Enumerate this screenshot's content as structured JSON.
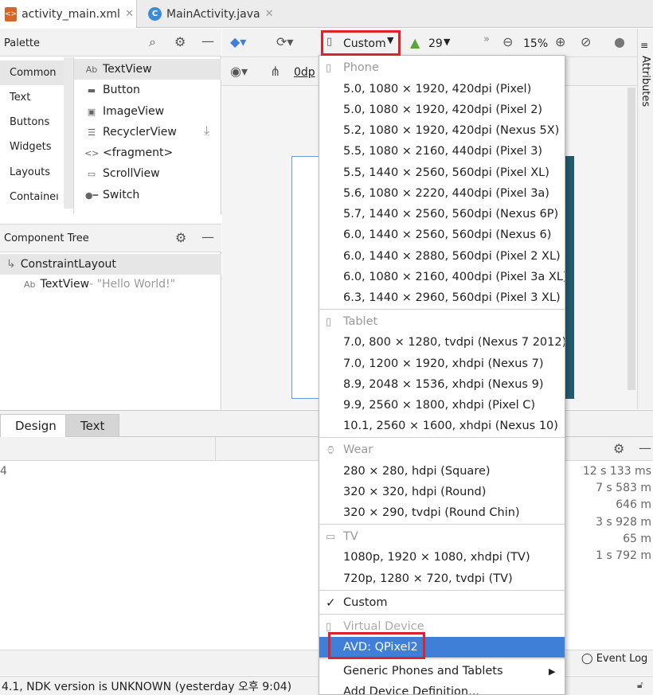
{
  "tabs": [
    {
      "label": "activity_main.xml",
      "active": true
    },
    {
      "label": "MainActivity.java",
      "active": false
    }
  ],
  "palette": {
    "title": "Palette",
    "categories": [
      "Common",
      "Text",
      "Buttons",
      "Widgets",
      "Layouts",
      "Containeı"
    ],
    "items": [
      "TextView",
      "Button",
      "ImageView",
      "RecyclerView",
      "<fragment>",
      "ScrollView",
      "Switch"
    ]
  },
  "component_tree": {
    "title": "Component Tree",
    "root": "ConstraintLayout",
    "child_label": "TextView",
    "child_value": "- \"Hello World!\""
  },
  "toolbar": {
    "device_label": "Custom",
    "api_level": "29",
    "zoom": "15%",
    "margin_value": "0dp"
  },
  "attributes_label": "Attributes",
  "design_tabs": [
    "Design",
    "Text"
  ],
  "run_timings": [
    "12 s 133 ms",
    "7 s 583 m",
    "646 m",
    "3 s 928 m",
    "65 m",
    "1 s 792 m"
  ],
  "run_left_text": "4",
  "event_log": "Event Log",
  "status_text": "4.1, NDK version is UNKNOWN (yesterday 오후 9:04)",
  "dropdown": {
    "phone_header": "Phone",
    "phone": [
      "5.0, 1080 × 1920, 420dpi (Pixel)",
      "5.0, 1080 × 1920, 420dpi (Pixel 2)",
      "5.2, 1080 × 1920, 420dpi (Nexus 5X)",
      "5.5, 1080 × 2160, 440dpi (Pixel 3)",
      "5.5, 1440 × 2560, 560dpi (Pixel XL)",
      "5.6, 1080 × 2220, 440dpi (Pixel 3a)",
      "5.7, 1440 × 2560, 560dpi (Nexus 6P)",
      "6.0, 1440 × 2560, 560dpi (Nexus 6)",
      "6.0, 1440 × 2880, 560dpi (Pixel 2 XL)",
      "6.0, 1080 × 2160, 400dpi (Pixel 3a XL)",
      "6.3, 1440 × 2960, 560dpi (Pixel 3 XL)"
    ],
    "tablet_header": "Tablet",
    "tablet": [
      "7.0, 800 × 1280, tvdpi (Nexus 7 2012)",
      "7.0, 1200 × 1920, xhdpi (Nexus 7)",
      "8.9, 2048 × 1536, xhdpi (Nexus 9)",
      "9.9, 2560 × 1800, xhdpi (Pixel C)",
      "10.1, 2560 × 1600, xhdpi (Nexus 10)"
    ],
    "wear_header": "Wear",
    "wear": [
      "280 × 280, hdpi (Square)",
      "320 × 320, hdpi (Round)",
      "320 × 290, tvdpi (Round Chin)"
    ],
    "tv_header": "TV",
    "tv": [
      "1080p, 1920 × 1080, xhdpi (TV)",
      "720p, 1280 × 720, tvdpi (TV)"
    ],
    "custom": "Custom",
    "virtual_header": "Virtual Device",
    "avd": "AVD: QPixel2",
    "generic": "Generic Phones and Tablets",
    "add_device": "Add Device Definition..."
  },
  "colors": {
    "highlight": "#d6262b",
    "selection": "#3f7fd8",
    "blueprint": "#235b6e"
  }
}
